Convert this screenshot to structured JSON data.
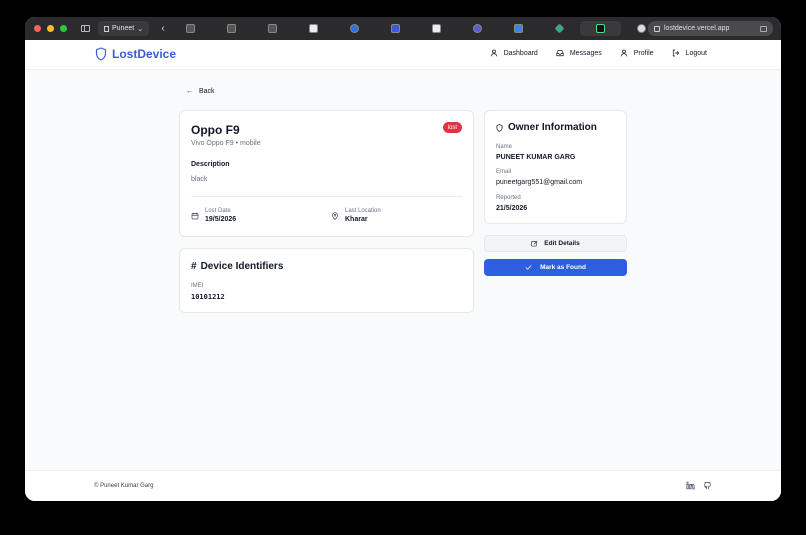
{
  "browser": {
    "profile_name": "Puneet",
    "url": "lostdevice.vercel.app",
    "tab_count": 12
  },
  "brand": {
    "name": "LostDevice",
    "color": "#3b5bdb"
  },
  "nav": {
    "items": [
      {
        "label": "Dashboard",
        "icon": "user-icon"
      },
      {
        "label": "Messages",
        "icon": "inbox-icon"
      },
      {
        "label": "Profile",
        "icon": "user-icon"
      },
      {
        "label": "Logout",
        "icon": "logout-icon"
      }
    ]
  },
  "page": {
    "back_label": "Back",
    "device": {
      "name": "Oppo F9",
      "status": "lost",
      "status_color": "#dc3545",
      "subtitle": "Vivo Oppo F9 • mobile",
      "description_heading": "Description",
      "description": "black",
      "lost_date_label": "Lost Date",
      "lost_date": "19/5/2026",
      "location_label": "Last Location",
      "location": "Kharar"
    },
    "identifiers": {
      "title": "Device Identifiers",
      "imei_label": "IMEI",
      "imei": "10101212"
    },
    "owner": {
      "title": "Owner Information",
      "name_label": "Name",
      "name": "PUNEET KUMAR GARG",
      "email_label": "Email",
      "email": "puneetgarg551@gmail.com",
      "reported_label": "Reported",
      "reported": "21/5/2026"
    },
    "actions": {
      "edit_label": "Edit Details",
      "found_label": "Mark as Found",
      "primary_color": "#2f5fe0"
    }
  },
  "footer": {
    "copyright": "© Puneet Kumar Garg"
  }
}
